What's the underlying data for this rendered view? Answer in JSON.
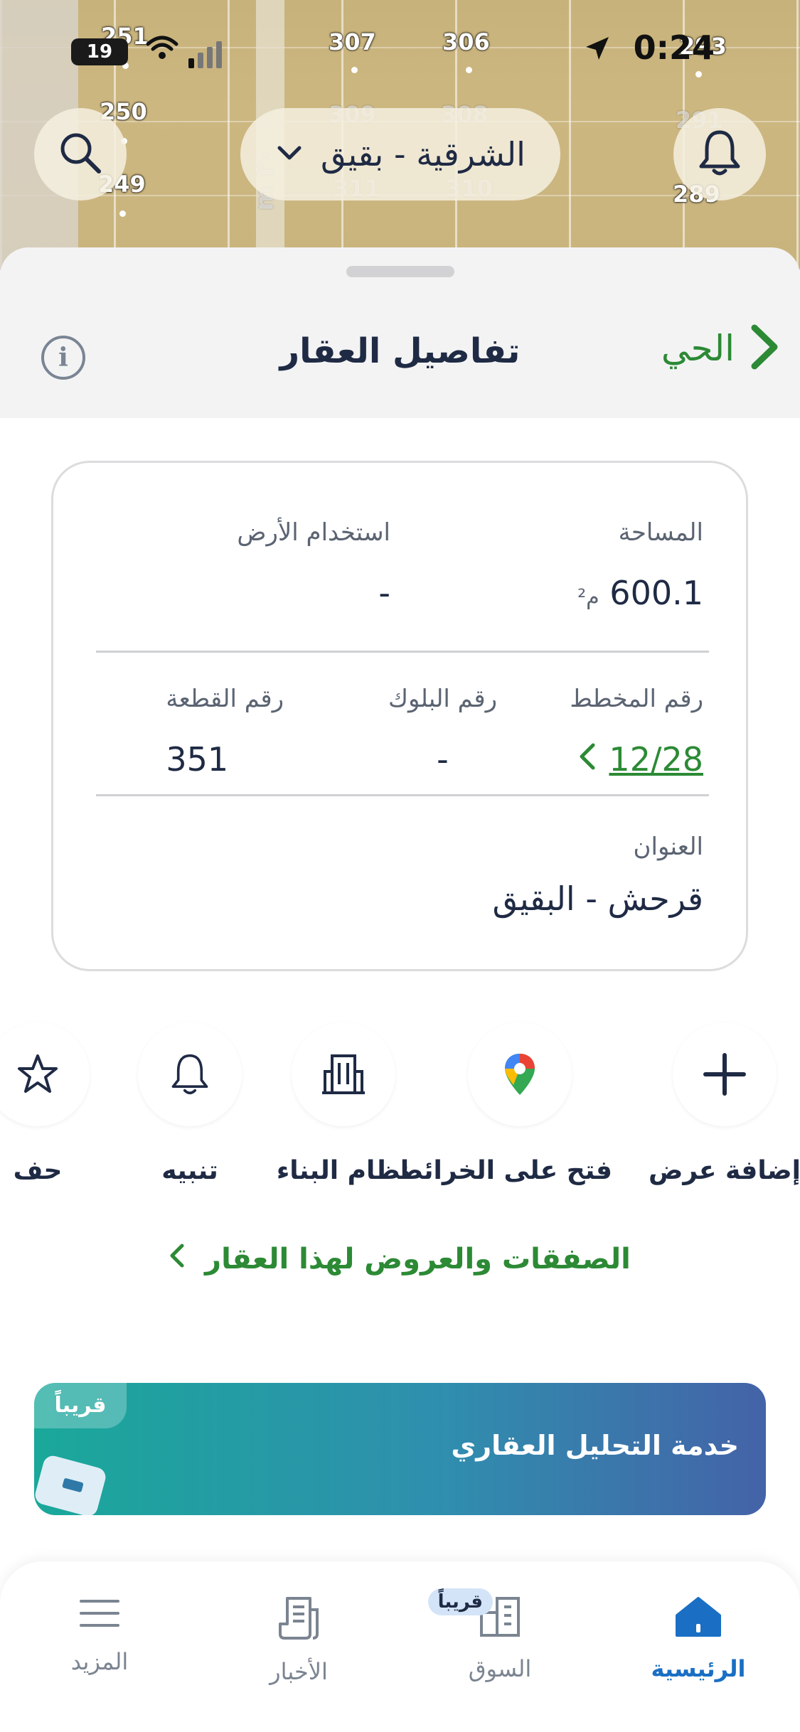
{
  "status_bar": {
    "time": "0:24",
    "battery": "19"
  },
  "map": {
    "parcels": [
      "251",
      "307",
      "306",
      "293",
      "250",
      "309",
      "308",
      "291",
      "249",
      "311",
      "310",
      "289"
    ],
    "scale_label": "۲۰ m"
  },
  "top_bar": {
    "region_selector": "الشرقية - بقيق"
  },
  "sheet": {
    "back_label": "الحي",
    "title": "تفاصيل العقار"
  },
  "details": {
    "area_label": "المساحة",
    "area_value": "600.1",
    "area_unit": "م²",
    "land_use_label": "استخدام الأرض",
    "land_use_value": "-",
    "plan_number_label": "رقم المخطط",
    "plan_number_value": "12/28",
    "block_number_label": "رقم البلوك",
    "block_number_value": "-",
    "plot_number_label": "رقم القطعة",
    "plot_number_value": "351",
    "address_label": "العنوان",
    "address_value": "قرحش - البقيق"
  },
  "actions": [
    {
      "label": "إضافة عرض",
      "icon": "plus-icon"
    },
    {
      "label": "فتح على الخرائط",
      "icon": "google-maps-pin-icon"
    },
    {
      "label": "نظام البناء",
      "icon": "building-icon"
    },
    {
      "label": "تنبيه",
      "icon": "bell-icon"
    },
    {
      "label": "حف",
      "icon": "star-icon"
    }
  ],
  "deals_link": "الصفقات والعروض لهذا العقار",
  "banner": {
    "badge": "قريباً",
    "title": "خدمة التحليل العقاري"
  },
  "bottom_nav": [
    {
      "label": "الرئيسية",
      "icon": "home-icon",
      "active": true
    },
    {
      "label": "السوق",
      "icon": "market-icon",
      "badge": "قريباً"
    },
    {
      "label": "الأخبار",
      "icon": "news-icon"
    },
    {
      "label": "المزيد",
      "icon": "menu-icon"
    }
  ],
  "colors": {
    "accent_green": "#2c8a35",
    "accent_blue": "#1a6fc4",
    "text_dark": "#1f2a44",
    "banner_start": "#1aa89a",
    "banner_end": "#4463a8"
  }
}
